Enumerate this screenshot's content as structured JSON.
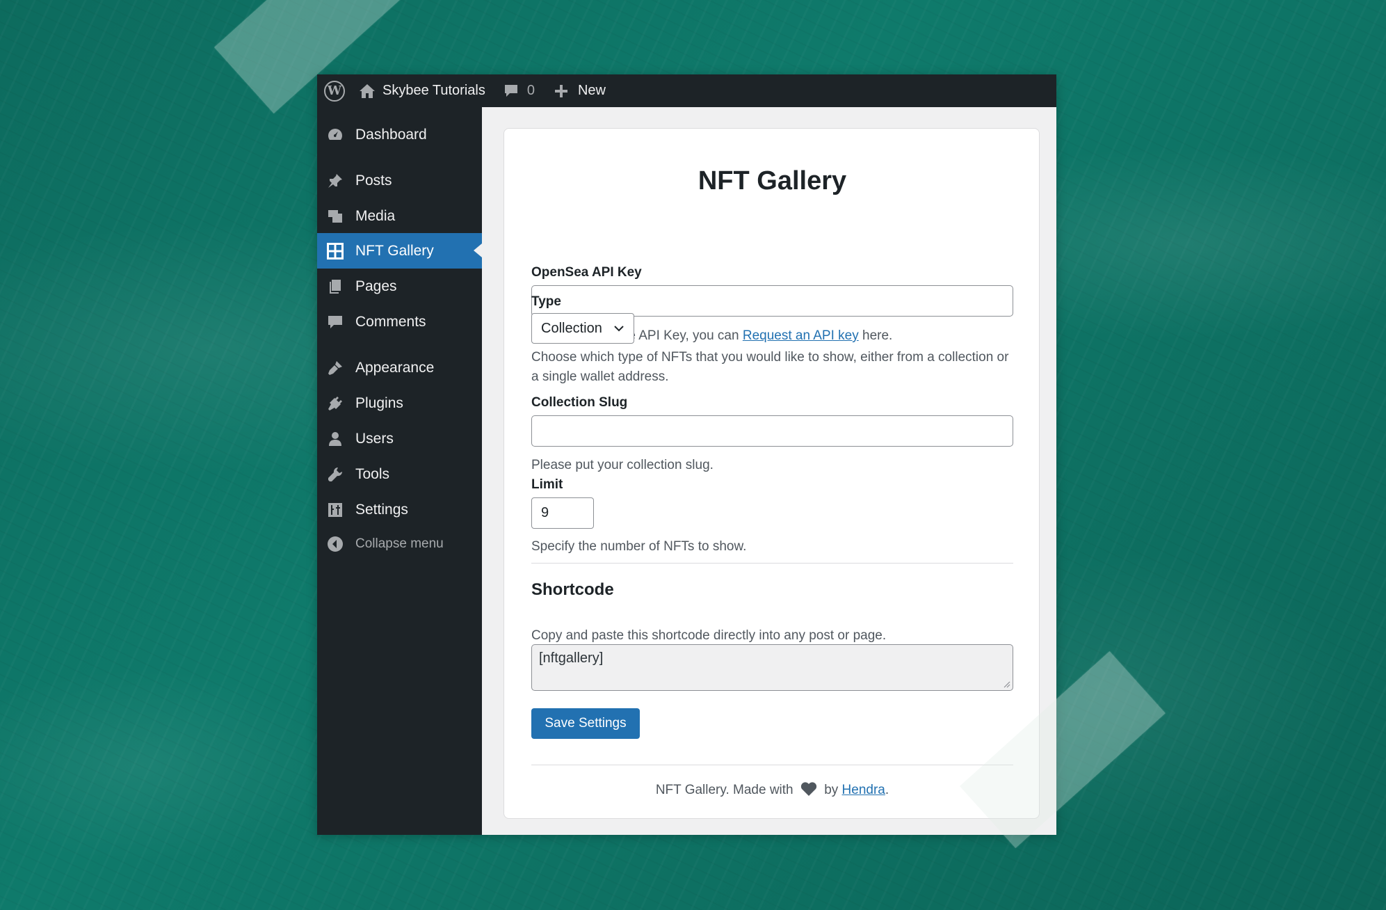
{
  "admin_bar": {
    "site_name": "Skybee Tutorials",
    "comments_count": "0",
    "new_label": "New"
  },
  "sidebar": {
    "items": [
      {
        "label": "Dashboard",
        "icon": "dashboard-icon"
      },
      {
        "label": "Posts",
        "icon": "pin-icon"
      },
      {
        "label": "Media",
        "icon": "media-icon"
      },
      {
        "label": "NFT Gallery",
        "icon": "grid-icon",
        "active": true
      },
      {
        "label": "Pages",
        "icon": "pages-icon"
      },
      {
        "label": "Comments",
        "icon": "comment-icon"
      },
      {
        "label": "Appearance",
        "icon": "brush-icon"
      },
      {
        "label": "Plugins",
        "icon": "plug-icon"
      },
      {
        "label": "Users",
        "icon": "user-icon"
      },
      {
        "label": "Tools",
        "icon": "wrench-icon"
      },
      {
        "label": "Settings",
        "icon": "sliders-icon"
      }
    ],
    "collapse_label": "Collapse menu"
  },
  "form": {
    "title": "NFT Gallery",
    "api_key": {
      "label": "OpenSea API Key",
      "value": "",
      "help_before": "In order to get the API Key, you can ",
      "help_link": "Request an API key",
      "help_after": " here."
    },
    "type": {
      "label": "Type",
      "selected": "Collection",
      "help": "Choose which type of NFTs that you would like to show, either from a collection or a single wallet address."
    },
    "slug": {
      "label": "Collection Slug",
      "value": "",
      "help": "Please put your collection slug."
    },
    "limit": {
      "label": "Limit",
      "value": "9",
      "help": "Specify the number of NFTs to show."
    },
    "shortcode": {
      "title": "Shortcode",
      "help": "Copy and paste this shortcode directly into any post or page.",
      "value": "[nftgallery]"
    },
    "save_label": "Save Settings",
    "footer": {
      "before": "NFT Gallery. Made with",
      "by": "by",
      "author": "Hendra",
      "end": "."
    }
  },
  "colors": {
    "accent": "#2271b1",
    "admin_dark": "#1d2327",
    "background": "#0f7a6b"
  }
}
